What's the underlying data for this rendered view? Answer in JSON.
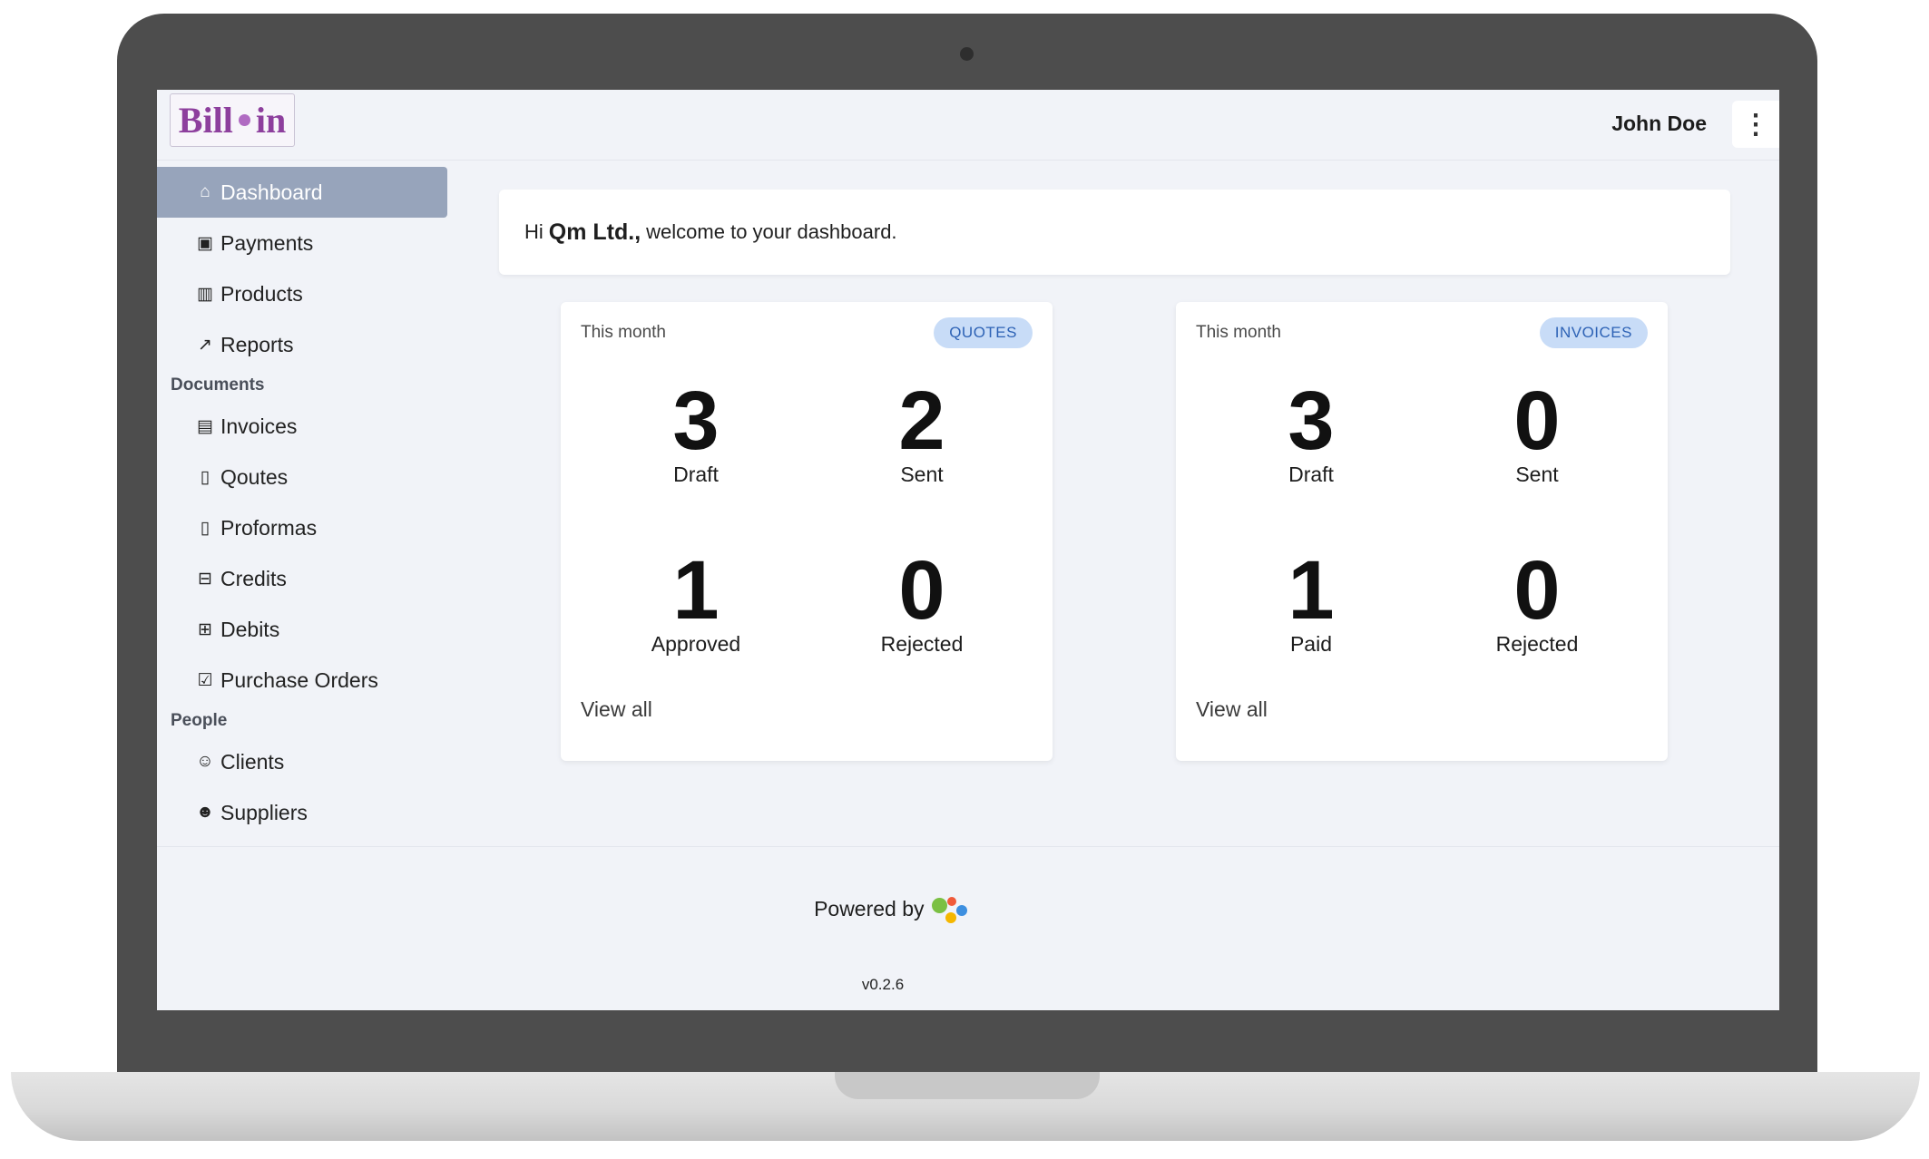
{
  "header": {
    "logo_left": "Bill",
    "logo_right": "in",
    "user_name": "John Doe",
    "menu_icon": "⋮"
  },
  "sidebar": {
    "top_items": [
      {
        "label": "Dashboard",
        "icon": "home-icon",
        "glyph": "⌂",
        "active": true
      },
      {
        "label": "Payments",
        "icon": "payments-icon",
        "glyph": "▣"
      },
      {
        "label": "Products",
        "icon": "products-icon",
        "glyph": "▥"
      },
      {
        "label": "Reports",
        "icon": "chart-line-icon",
        "glyph": "↗"
      }
    ],
    "documents_label": "Documents",
    "documents": [
      {
        "label": "Invoices",
        "icon": "invoice-icon",
        "glyph": "▤"
      },
      {
        "label": "Qoutes",
        "icon": "quote-icon",
        "glyph": "▯"
      },
      {
        "label": "Proformas",
        "icon": "proforma-icon",
        "glyph": "▯"
      },
      {
        "label": "Credits",
        "icon": "credit-bag-icon",
        "glyph": "⊟"
      },
      {
        "label": "Debits",
        "icon": "debit-bag-icon",
        "glyph": "⊞"
      },
      {
        "label": "Purchase Orders",
        "icon": "purchase-bag-icon",
        "glyph": "☑"
      }
    ],
    "people_label": "People",
    "people": [
      {
        "label": "Clients",
        "icon": "clients-icon",
        "glyph": "☺"
      },
      {
        "label": "Suppliers",
        "icon": "suppliers-icon",
        "glyph": "☻"
      }
    ]
  },
  "welcome": {
    "prefix": "Hi",
    "company": "Qm Ltd.,",
    "suffix": "welcome to your dashboard."
  },
  "quotes_card": {
    "period": "This month",
    "badge": "QUOTES",
    "stats": [
      {
        "value": "3",
        "label": "Draft"
      },
      {
        "value": "2",
        "label": "Sent"
      },
      {
        "value": "1",
        "label": "Approved"
      },
      {
        "value": "0",
        "label": "Rejected"
      }
    ],
    "link": "View all"
  },
  "invoices_card": {
    "period": "This month",
    "badge": "INVOICES",
    "stats": [
      {
        "value": "3",
        "label": "Draft"
      },
      {
        "value": "0",
        "label": "Sent"
      },
      {
        "value": "1",
        "label": "Paid"
      },
      {
        "value": "0",
        "label": "Rejected"
      }
    ],
    "link": "View all"
  },
  "footer": {
    "powered_by": "Powered by",
    "version": "v0.2.6"
  },
  "colors": {
    "sidebar_active": "#97a4bb",
    "badge_bg": "#c8dcf7",
    "badge_text": "#2d62b5",
    "logo": "#8d3f9d"
  }
}
